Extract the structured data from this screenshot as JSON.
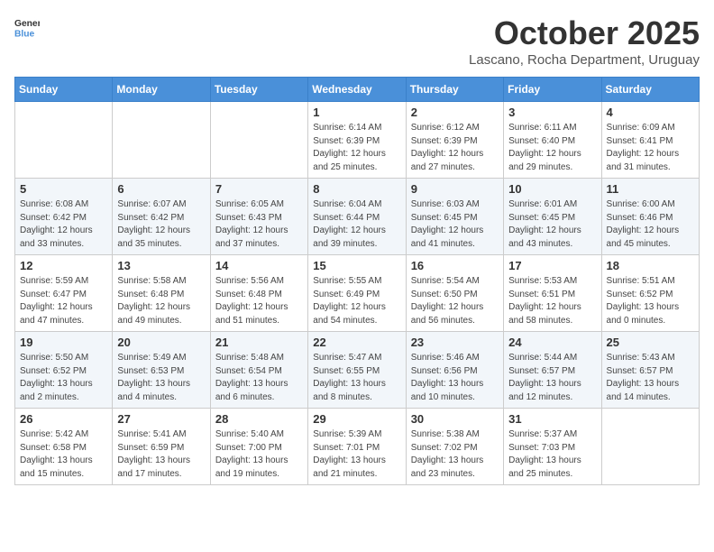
{
  "header": {
    "logo_general": "General",
    "logo_blue": "Blue",
    "month": "October 2025",
    "location": "Lascano, Rocha Department, Uruguay"
  },
  "days_of_week": [
    "Sunday",
    "Monday",
    "Tuesday",
    "Wednesday",
    "Thursday",
    "Friday",
    "Saturday"
  ],
  "weeks": [
    [
      {
        "day": "",
        "info": ""
      },
      {
        "day": "",
        "info": ""
      },
      {
        "day": "",
        "info": ""
      },
      {
        "day": "1",
        "info": "Sunrise: 6:14 AM\nSunset: 6:39 PM\nDaylight: 12 hours\nand 25 minutes."
      },
      {
        "day": "2",
        "info": "Sunrise: 6:12 AM\nSunset: 6:39 PM\nDaylight: 12 hours\nand 27 minutes."
      },
      {
        "day": "3",
        "info": "Sunrise: 6:11 AM\nSunset: 6:40 PM\nDaylight: 12 hours\nand 29 minutes."
      },
      {
        "day": "4",
        "info": "Sunrise: 6:09 AM\nSunset: 6:41 PM\nDaylight: 12 hours\nand 31 minutes."
      }
    ],
    [
      {
        "day": "5",
        "info": "Sunrise: 6:08 AM\nSunset: 6:42 PM\nDaylight: 12 hours\nand 33 minutes."
      },
      {
        "day": "6",
        "info": "Sunrise: 6:07 AM\nSunset: 6:42 PM\nDaylight: 12 hours\nand 35 minutes."
      },
      {
        "day": "7",
        "info": "Sunrise: 6:05 AM\nSunset: 6:43 PM\nDaylight: 12 hours\nand 37 minutes."
      },
      {
        "day": "8",
        "info": "Sunrise: 6:04 AM\nSunset: 6:44 PM\nDaylight: 12 hours\nand 39 minutes."
      },
      {
        "day": "9",
        "info": "Sunrise: 6:03 AM\nSunset: 6:45 PM\nDaylight: 12 hours\nand 41 minutes."
      },
      {
        "day": "10",
        "info": "Sunrise: 6:01 AM\nSunset: 6:45 PM\nDaylight: 12 hours\nand 43 minutes."
      },
      {
        "day": "11",
        "info": "Sunrise: 6:00 AM\nSunset: 6:46 PM\nDaylight: 12 hours\nand 45 minutes."
      }
    ],
    [
      {
        "day": "12",
        "info": "Sunrise: 5:59 AM\nSunset: 6:47 PM\nDaylight: 12 hours\nand 47 minutes."
      },
      {
        "day": "13",
        "info": "Sunrise: 5:58 AM\nSunset: 6:48 PM\nDaylight: 12 hours\nand 49 minutes."
      },
      {
        "day": "14",
        "info": "Sunrise: 5:56 AM\nSunset: 6:48 PM\nDaylight: 12 hours\nand 51 minutes."
      },
      {
        "day": "15",
        "info": "Sunrise: 5:55 AM\nSunset: 6:49 PM\nDaylight: 12 hours\nand 54 minutes."
      },
      {
        "day": "16",
        "info": "Sunrise: 5:54 AM\nSunset: 6:50 PM\nDaylight: 12 hours\nand 56 minutes."
      },
      {
        "day": "17",
        "info": "Sunrise: 5:53 AM\nSunset: 6:51 PM\nDaylight: 12 hours\nand 58 minutes."
      },
      {
        "day": "18",
        "info": "Sunrise: 5:51 AM\nSunset: 6:52 PM\nDaylight: 13 hours\nand 0 minutes."
      }
    ],
    [
      {
        "day": "19",
        "info": "Sunrise: 5:50 AM\nSunset: 6:52 PM\nDaylight: 13 hours\nand 2 minutes."
      },
      {
        "day": "20",
        "info": "Sunrise: 5:49 AM\nSunset: 6:53 PM\nDaylight: 13 hours\nand 4 minutes."
      },
      {
        "day": "21",
        "info": "Sunrise: 5:48 AM\nSunset: 6:54 PM\nDaylight: 13 hours\nand 6 minutes."
      },
      {
        "day": "22",
        "info": "Sunrise: 5:47 AM\nSunset: 6:55 PM\nDaylight: 13 hours\nand 8 minutes."
      },
      {
        "day": "23",
        "info": "Sunrise: 5:46 AM\nSunset: 6:56 PM\nDaylight: 13 hours\nand 10 minutes."
      },
      {
        "day": "24",
        "info": "Sunrise: 5:44 AM\nSunset: 6:57 PM\nDaylight: 13 hours\nand 12 minutes."
      },
      {
        "day": "25",
        "info": "Sunrise: 5:43 AM\nSunset: 6:57 PM\nDaylight: 13 hours\nand 14 minutes."
      }
    ],
    [
      {
        "day": "26",
        "info": "Sunrise: 5:42 AM\nSunset: 6:58 PM\nDaylight: 13 hours\nand 15 minutes."
      },
      {
        "day": "27",
        "info": "Sunrise: 5:41 AM\nSunset: 6:59 PM\nDaylight: 13 hours\nand 17 minutes."
      },
      {
        "day": "28",
        "info": "Sunrise: 5:40 AM\nSunset: 7:00 PM\nDaylight: 13 hours\nand 19 minutes."
      },
      {
        "day": "29",
        "info": "Sunrise: 5:39 AM\nSunset: 7:01 PM\nDaylight: 13 hours\nand 21 minutes."
      },
      {
        "day": "30",
        "info": "Sunrise: 5:38 AM\nSunset: 7:02 PM\nDaylight: 13 hours\nand 23 minutes."
      },
      {
        "day": "31",
        "info": "Sunrise: 5:37 AM\nSunset: 7:03 PM\nDaylight: 13 hours\nand 25 minutes."
      },
      {
        "day": "",
        "info": ""
      }
    ]
  ]
}
